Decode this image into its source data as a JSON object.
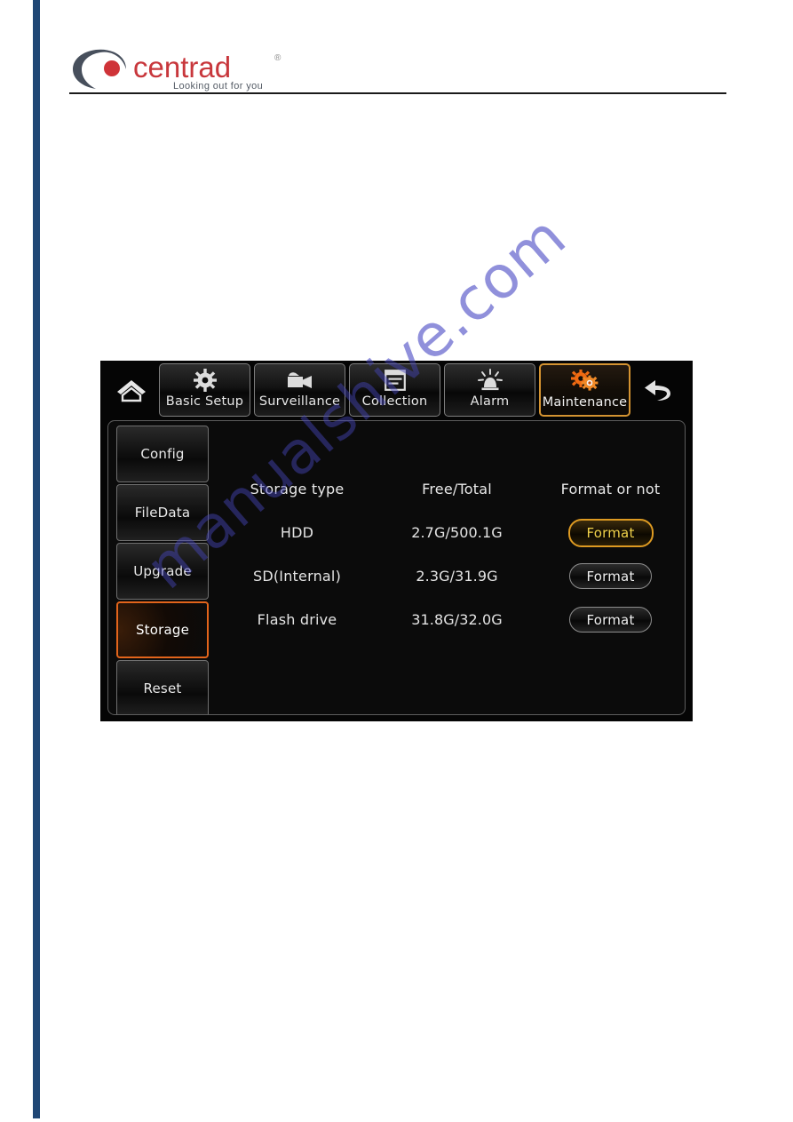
{
  "document": {
    "brand": {
      "name": "centrad",
      "tagline": "Looking out for you",
      "registered_mark": "®",
      "dot_color": "#cf3338",
      "text_color": "#c8373c",
      "swoosh_color": "#474f5c"
    },
    "watermark": "manualshive.com",
    "spine_color": "#1f4775"
  },
  "device": {
    "home_icon": "home-icon",
    "back_icon": "back-arrow-icon",
    "toolbar": {
      "tabs": [
        {
          "label": "Basic Setup",
          "icon": "gear-icon",
          "active": false
        },
        {
          "label": "Surveillance",
          "icon": "video-camera-icon",
          "active": false
        },
        {
          "label": "Collection",
          "icon": "list-window-icon",
          "active": false
        },
        {
          "label": "Alarm",
          "icon": "siren-icon",
          "active": false
        },
        {
          "label": "Maintenance",
          "icon": "double-gear-icon",
          "active": true
        }
      ]
    },
    "sidebar": {
      "items": [
        {
          "label": "Config",
          "active": false
        },
        {
          "label": "FileData",
          "active": false
        },
        {
          "label": "Upgrade",
          "active": false
        },
        {
          "label": "Storage",
          "active": true
        },
        {
          "label": "Reset",
          "active": false
        }
      ]
    },
    "storage_table": {
      "columns": [
        "Storage type",
        "Free/Total",
        "Format or not"
      ],
      "rows": [
        {
          "type": "HDD",
          "free_total": "2.7G/500.1G",
          "action": "Format",
          "highlighted": true
        },
        {
          "type": "SD(Internal)",
          "free_total": "2.3G/31.9G",
          "action": "Format",
          "highlighted": false
        },
        {
          "type": "Flash drive",
          "free_total": "31.8G/32.0G",
          "action": "Format",
          "highlighted": false
        }
      ]
    },
    "colors": {
      "active_tab_border": "#d49331",
      "active_sidebar_border": "#e2641b",
      "highlight_button_border": "#dd9a22",
      "highlight_button_text": "#f1d24a",
      "panel_background": "#0b0b0b"
    }
  }
}
